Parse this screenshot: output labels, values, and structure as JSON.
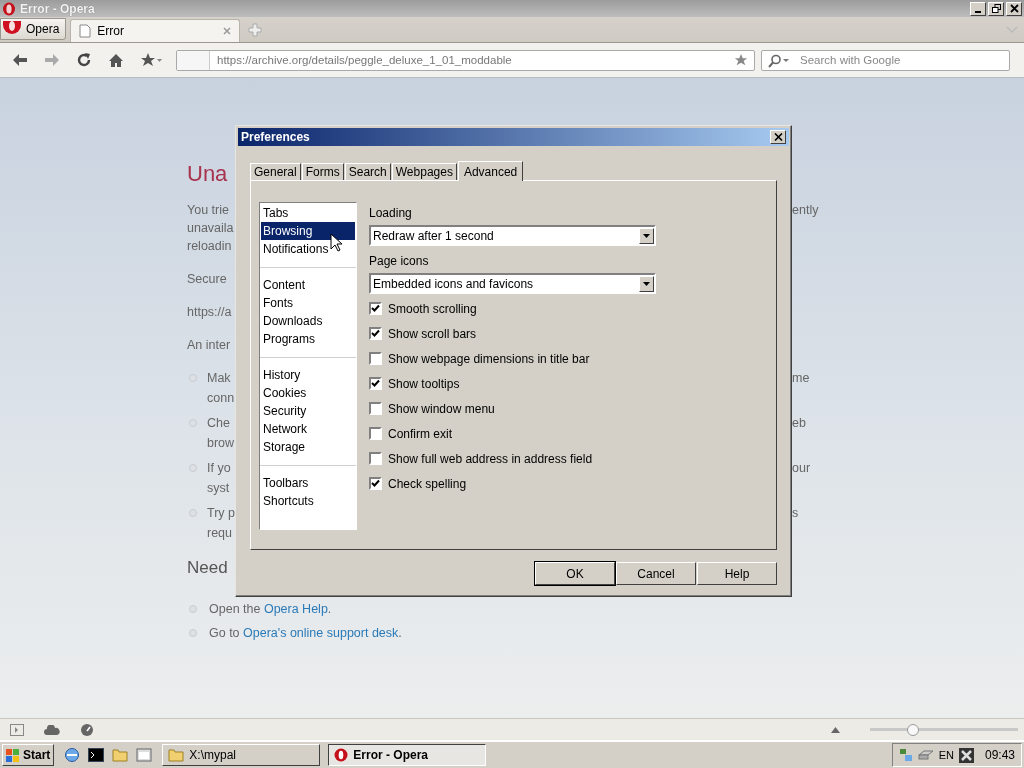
{
  "window": {
    "title": "Error - Opera"
  },
  "menu_button": {
    "label": "Opera"
  },
  "tabs": [
    {
      "label": "Error",
      "selected": true
    }
  ],
  "address_bar": {
    "url": "https://archive.org/details/peggle_deluxe_1_01_moddable"
  },
  "search": {
    "placeholder": "Search with Google"
  },
  "page": {
    "rows": [
      {
        "kind": "heading",
        "left": "Una"
      },
      {
        "kind": "first-line",
        "left": "You trie",
        "right": "ently"
      },
      {
        "kind": "line",
        "left": "unavaila"
      },
      {
        "kind": "line",
        "left": "reloadin"
      },
      {
        "kind": "first-line",
        "left": "Secure"
      },
      {
        "kind": "first-line",
        "left": "https://a"
      },
      {
        "kind": "first-line",
        "left": "An inter"
      },
      {
        "kind": "bullet",
        "left": "Mak",
        "right": "me"
      },
      {
        "kind": "bullet-cont",
        "left": "conn"
      },
      {
        "kind": "bullet",
        "left": "Che",
        "right": "eb"
      },
      {
        "kind": "bullet-cont",
        "left": "brow"
      },
      {
        "kind": "bullet",
        "left": "If yo",
        "right": "our"
      },
      {
        "kind": "bullet-cont",
        "left": "syst"
      },
      {
        "kind": "bullet",
        "left": "Try p",
        "right": "s"
      },
      {
        "kind": "bullet-cont",
        "left": "requ"
      },
      {
        "kind": "heading",
        "left": "Need"
      }
    ],
    "help_items": [
      {
        "before": "Open the ",
        "link": "Opera Help",
        "after": "."
      },
      {
        "before": "Go to ",
        "link": "Opera's online support desk",
        "after": "."
      }
    ]
  },
  "dialog": {
    "title": "Preferences",
    "tabs": [
      {
        "label": "General",
        "selected": false
      },
      {
        "label": "Forms",
        "selected": false
      },
      {
        "label": "Search",
        "selected": false
      },
      {
        "label": "Webpages",
        "selected": false
      },
      {
        "label": "Advanced",
        "selected": true
      }
    ],
    "category_groups": [
      {
        "items": [
          {
            "label": "Tabs",
            "selected": false
          },
          {
            "label": "Browsing",
            "selected": true
          },
          {
            "label": "Notifications",
            "selected": false
          }
        ]
      },
      {
        "items": [
          {
            "label": "Content",
            "selected": false
          },
          {
            "label": "Fonts",
            "selected": false
          },
          {
            "label": "Downloads",
            "selected": false
          },
          {
            "label": "Programs",
            "selected": false
          }
        ]
      },
      {
        "items": [
          {
            "label": "History",
            "selected": false
          },
          {
            "label": "Cookies",
            "selected": false
          },
          {
            "label": "Security",
            "selected": false
          },
          {
            "label": "Network",
            "selected": false
          },
          {
            "label": "Storage",
            "selected": false
          }
        ]
      },
      {
        "items": [
          {
            "label": "Toolbars",
            "selected": false
          },
          {
            "label": "Shortcuts",
            "selected": false
          }
        ]
      }
    ],
    "selects": [
      {
        "label": "Loading",
        "value": "Redraw after 1 second"
      },
      {
        "label": "Page icons",
        "value": "Embedded icons and favicons"
      }
    ],
    "options": [
      {
        "label": "Smooth scrolling",
        "checked": true
      },
      {
        "label": "Show scroll bars",
        "checked": true
      },
      {
        "label": "Show webpage dimensions in title bar",
        "checked": false
      },
      {
        "label": "Show tooltips",
        "checked": true
      },
      {
        "label": "Show window menu",
        "checked": false
      },
      {
        "label": "Confirm exit",
        "checked": false
      },
      {
        "label": "Show full web address in address field",
        "checked": false
      },
      {
        "label": "Check spelling",
        "checked": true
      }
    ],
    "buttons": [
      {
        "label": "OK",
        "default": true
      },
      {
        "label": "Cancel",
        "default": false
      },
      {
        "label": "Help",
        "default": false
      }
    ]
  },
  "status_bar": {
    "zoom": {
      "level": 0.27
    }
  },
  "taskbar": {
    "start": "Start",
    "tasks": [
      {
        "kind": "folder",
        "label": "X:\\mypal",
        "selected": false
      },
      {
        "kind": "opera",
        "label": "Error - Opera",
        "selected": true
      }
    ],
    "language": "EN",
    "time": "09:43"
  }
}
